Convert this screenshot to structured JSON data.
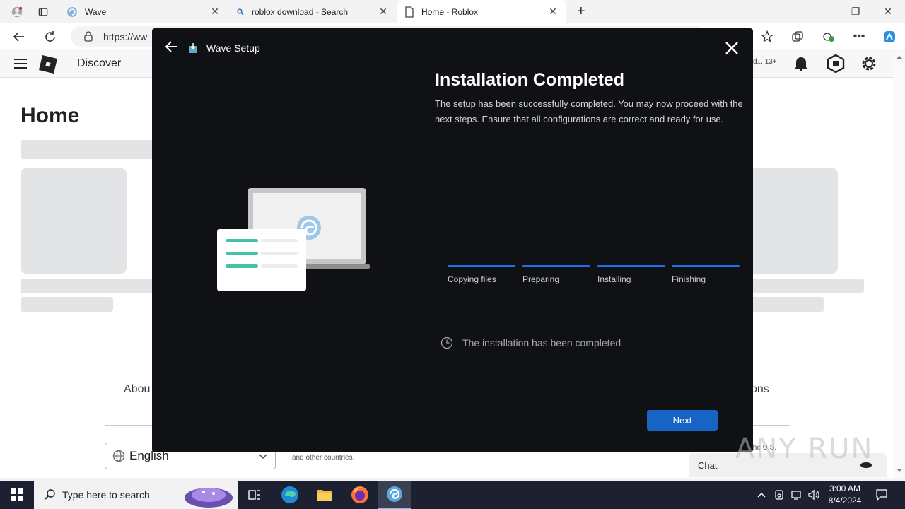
{
  "browser": {
    "tabs": [
      {
        "title": "Wave",
        "close": "✕"
      },
      {
        "title": "roblox download - Search",
        "close": "✕"
      },
      {
        "title": "Home - Roblox",
        "close": "✕"
      }
    ],
    "new_tab": "+",
    "url": "https://ww",
    "window_controls": {
      "minimize": "—",
      "restore": "❐",
      "close": "✕"
    }
  },
  "roblox": {
    "nav_label": "Discover",
    "age_badge": "13+",
    "home_title": "Home",
    "footer_links": [
      "Abou",
      "ons"
    ],
    "language": "English",
    "copyright_fragment": "and other countries.",
    "copyright_right": "the U.S.",
    "chat_label": "Chat"
  },
  "installer": {
    "window_title": "Wave Setup",
    "heading": "Installation Completed",
    "description": "The setup has been successfully completed. You may now proceed with the next steps. Ensure that all configurations are correct and ready for use.",
    "steps": [
      {
        "label": "Copying files",
        "progress": 1.0
      },
      {
        "label": "Preparing",
        "progress": 1.0
      },
      {
        "label": "Installing",
        "progress": 1.0
      },
      {
        "label": "Finishing",
        "progress": 1.0
      }
    ],
    "status": "The installation has been completed",
    "next_label": "Next",
    "accent_color": "#1a73e8"
  },
  "taskbar": {
    "search_placeholder": "Type here to search",
    "time": "3:00 AM",
    "date": "8/4/2024"
  },
  "watermark": "ANY RUN"
}
